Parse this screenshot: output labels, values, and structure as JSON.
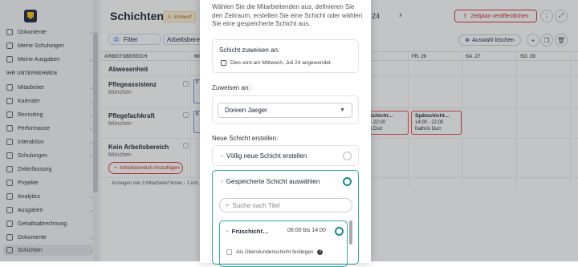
{
  "sidebar": {
    "items_top": [
      {
        "label": "Dokumente"
      },
      {
        "label": "Meine Schulungen"
      },
      {
        "label": "Meine Ausgaben"
      }
    ],
    "section": "IHR UNTERNEHMEN",
    "items": [
      {
        "label": "Mitarbeiter"
      },
      {
        "label": "Kalender"
      },
      {
        "label": "Recruiting"
      },
      {
        "label": "Performance"
      },
      {
        "label": "Interaktion"
      },
      {
        "label": "Schulungen"
      },
      {
        "label": "Zeiterfassung"
      },
      {
        "label": "Projekte"
      },
      {
        "label": "Analytics"
      },
      {
        "label": "Ausgaben"
      },
      {
        "label": "Gehaltsabrechnung"
      },
      {
        "label": "Dokumente"
      },
      {
        "label": "Schichten"
      }
    ]
  },
  "header": {
    "title": "Schichten",
    "badge": "Entwurf",
    "badge_icon": "⚠",
    "num": "24",
    "publish": "Zeitplan veröffentlichen"
  },
  "toolbar": {
    "filter": "Filter",
    "filter_count": "2",
    "area": "Arbeitsbereich",
    "clear": "Auswahl löschen"
  },
  "grid": {
    "col_area": "ARBEITSBEREICH",
    "col_mo": "MO",
    "days": [
      {
        "label": "FR. 26"
      },
      {
        "label": "SA. 27"
      },
      {
        "label": "SO. 28"
      }
    ],
    "rows": [
      {
        "title": "Abwesenheit",
        "sub": ""
      },
      {
        "title": "Pflegeassistenz",
        "sub": "München"
      },
      {
        "title": "Pflegefachkraft",
        "sub": "München"
      },
      {
        "title": "Kein Arbeitsbereich",
        "sub": "München"
      }
    ],
    "add_area": "Arbeitsbereich hinzufügen",
    "footer": "Anzeigen von 3 Mitarbeiter*innen - 1 Arb",
    "shift1": {
      "name": "Schicht…",
      "time": "– 22:00",
      "person": "n Durr"
    },
    "shift2": {
      "name": "Spätschicht…",
      "time": "14:00 - 22:00",
      "person": "Kathrin Durr"
    },
    "stub_a": "F",
    "stub_b": "K"
  },
  "modal": {
    "intro": "Wählen Sie die Mitarbeitenden aus, definieren Sie den Zeitraum, erstellen Sie eine Schicht oder wählen Sie eine gespeicherte Schicht aus.",
    "assign_label": "Schicht zuweisen an:",
    "assign_info": "Dies wird am Mittwoch, Juli 24 angewendet.",
    "assign_to_label": "Zuweisen an:",
    "assignee": "Doreen Jaeger",
    "new_shift_label": "Neue Schicht erstellen:",
    "opt_new": "Völlig neue Schicht erstellen",
    "opt_saved": "Gespeicherte Schicht auswählen",
    "search_placeholder": "Suche nach Titel",
    "saved_shift": {
      "name": "Früschicht…",
      "time": "06:00 bis 14:00"
    },
    "overtime": "Als Überstundenschicht festlegen"
  }
}
